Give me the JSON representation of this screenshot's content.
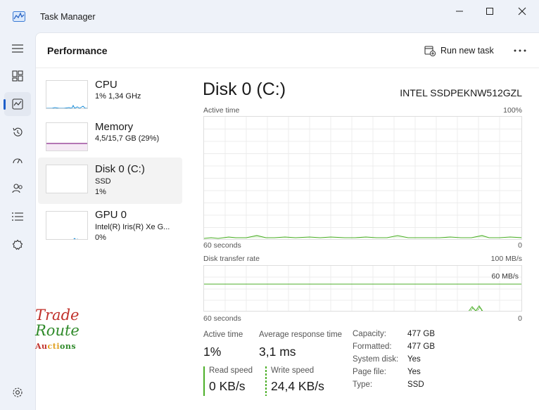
{
  "window": {
    "title": "Task Manager"
  },
  "page": {
    "title": "Performance"
  },
  "toolbar": {
    "run_new_task": "Run new task"
  },
  "rail": {
    "items": [
      {
        "icon": "hamburger-menu-icon"
      },
      {
        "icon": "processes-icon"
      },
      {
        "icon": "performance-icon",
        "active": true
      },
      {
        "icon": "app-history-icon"
      },
      {
        "icon": "startup-apps-icon"
      },
      {
        "icon": "users-icon"
      },
      {
        "icon": "details-icon"
      },
      {
        "icon": "services-icon"
      },
      {
        "icon": "settings-icon"
      }
    ]
  },
  "devices": [
    {
      "name": "CPU",
      "sub1": "1% 1,34 GHz",
      "sub2": ""
    },
    {
      "name": "Memory",
      "sub1": "4,5/15,7 GB (29%)",
      "sub2": ""
    },
    {
      "name": "Disk 0 (C:)",
      "sub1": "SSD",
      "sub2": "1%",
      "selected": true
    },
    {
      "name": "GPU 0",
      "sub1": "Intel(R) Iris(R) Xe G...",
      "sub2": "0%"
    }
  ],
  "detail": {
    "title": "Disk 0 (C:)",
    "model": "INTEL SSDPEKNW512GZL",
    "active_time_graph": {
      "label": "Active time",
      "max": "100%",
      "time_label": "60 seconds",
      "min": "0"
    },
    "transfer_graph": {
      "label": "Disk transfer rate",
      "max": "100 MB/s",
      "marker": "60 MB/s",
      "time_label": "60 seconds",
      "min": "0"
    }
  },
  "stats": {
    "active_time_label": "Active time",
    "active_time_value": "1%",
    "avg_response_label": "Average response time",
    "avg_response_value": "3,1 ms",
    "read_label": "Read speed",
    "read_value": "0 KB/s",
    "write_label": "Write speed",
    "write_value": "24,4 KB/s"
  },
  "properties": [
    {
      "key": "Capacity:",
      "value": "477 GB"
    },
    {
      "key": "Formatted:",
      "value": "477 GB"
    },
    {
      "key": "System disk:",
      "value": "Yes"
    },
    {
      "key": "Page file:",
      "value": "Yes"
    },
    {
      "key": "Type:",
      "value": "SSD"
    }
  ],
  "watermark": {
    "line1": "Trade",
    "line2": "Route",
    "line3": "Auctions"
  },
  "colors": {
    "accent": "#1f5fc9",
    "disk_green": "#4caf28",
    "memory_purple": "#8b2a8c",
    "cpu_blue": "#1e8fd8"
  }
}
